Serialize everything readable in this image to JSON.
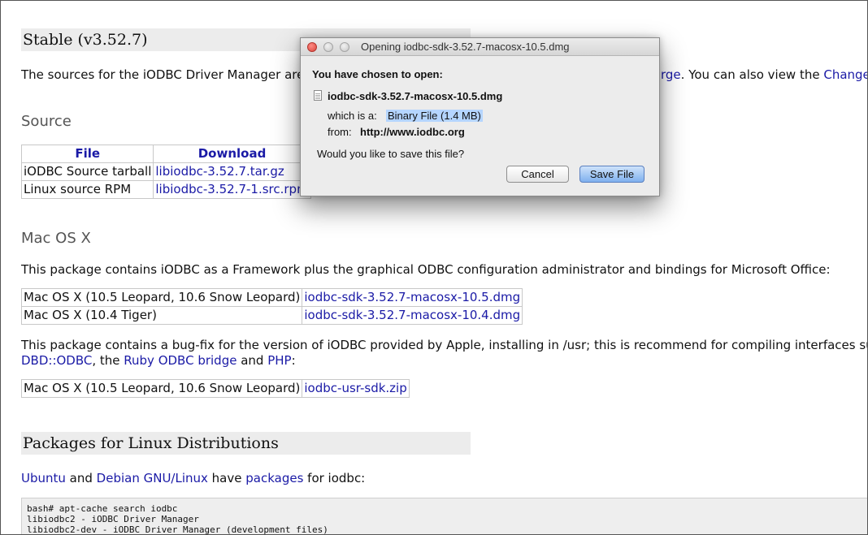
{
  "page": {
    "stable_heading": "Stable (v3.52.7)",
    "intro": {
      "prefix": "The sources for the iODBC Driver Manager are a",
      "link_forge": "rge",
      "middle": ". You can also view the ",
      "link_changelog": "Change"
    },
    "source_heading": "Source",
    "source_table": {
      "headers": [
        "File",
        "Download"
      ],
      "rows": [
        {
          "file": "iODBC Source tarball",
          "download": "libiodbc-3.52.7.tar.gz"
        },
        {
          "file": "Linux source RPM",
          "download": "libiodbc-3.52.7-1.src.rpm"
        }
      ]
    },
    "macosx_heading": "Mac OS X",
    "macosx_desc": "This package contains iODBC as a Framework plus the graphical ODBC configuration administrator and bindings for Microsoft Office:",
    "mac_table": [
      {
        "platform": "Mac OS X (10.5 Leopard, 10.6 Snow Leopard)",
        "download": "iodbc-sdk-3.52.7-macosx-10.5.dmg"
      },
      {
        "platform": "Mac OS X (10.4 Tiger)",
        "download": "iodbc-sdk-3.52.7-macosx-10.4.dmg"
      }
    ],
    "bugfix": {
      "line1": "This package contains a bug-fix for the version of iODBC provided by Apple, installing in /usr; this is recommend for compiling interfaces such a",
      "link_dbd": "DBD::ODBC",
      "sep1": ", the ",
      "link_ruby": "Ruby ODBC bridge",
      "sep2": " and ",
      "link_php": "PHP",
      "end": ":"
    },
    "usr_table": [
      {
        "platform": "Mac OS X (10.5 Leopard, 10.6 Snow Leopard)",
        "download": "iodbc-usr-sdk.zip"
      }
    ],
    "linux_heading": "Packages for Linux Distributions",
    "linux_line": {
      "link_ubuntu": "Ubuntu",
      "and": " and ",
      "link_debian": "Debian GNU/Linux",
      "have": " have ",
      "link_packages": "packages",
      "end": " for iodbc:"
    },
    "code_lines": [
      "bash# apt-cache search iodbc",
      "libiodbc2 - iODBC Driver Manager",
      "libiodbc2-dev - iODBC Driver Manager (development files)"
    ]
  },
  "dialog": {
    "title": "Opening iodbc-sdk-3.52.7-macosx-10.5.dmg",
    "chosen_label": "You have chosen to open:",
    "filename": "iodbc-sdk-3.52.7-macosx-10.5.dmg",
    "which_is_label": "which is a:",
    "which_is_value": "Binary File (1.4 MB)",
    "from_label": "from:",
    "from_value": "http://www.iodbc.org",
    "question": "Would you like to save this file?",
    "cancel_label": "Cancel",
    "save_label": "Save File"
  },
  "colors": {
    "link": "#1a1aa6",
    "heading_bar": "#ececec",
    "primary_button": "#7fb0ee"
  }
}
